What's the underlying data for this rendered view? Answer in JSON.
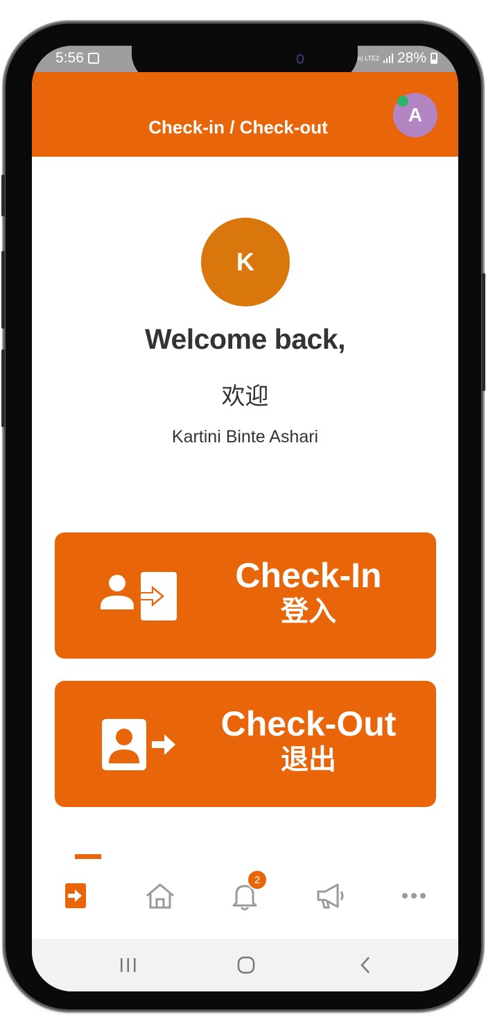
{
  "status_bar": {
    "time": "5:56",
    "network": "Vo) LTE2",
    "battery": "28%"
  },
  "app_bar": {
    "title": "Check-in / Check-out",
    "avatar_initial": "A"
  },
  "profile": {
    "avatar_initial": "K",
    "welcome": "Welcome back,",
    "welcome_zh": "欢迎",
    "name": "Kartini Binte Ashari"
  },
  "actions": {
    "check_in": {
      "label": "Check-In",
      "label_zh": "登入"
    },
    "check_out": {
      "label": "Check-Out",
      "label_zh": "退出"
    }
  },
  "bottom_nav": {
    "items": [
      {
        "icon": "check-in-icon",
        "active": true
      },
      {
        "icon": "home-icon"
      },
      {
        "icon": "bell-icon",
        "badge": "2"
      },
      {
        "icon": "megaphone-icon"
      },
      {
        "icon": "more-icon"
      }
    ]
  },
  "colors": {
    "primary": "#e8650a",
    "profile_avatar": "#d9770c",
    "user_avatar": "#b285c2",
    "online": "#2db36b"
  }
}
